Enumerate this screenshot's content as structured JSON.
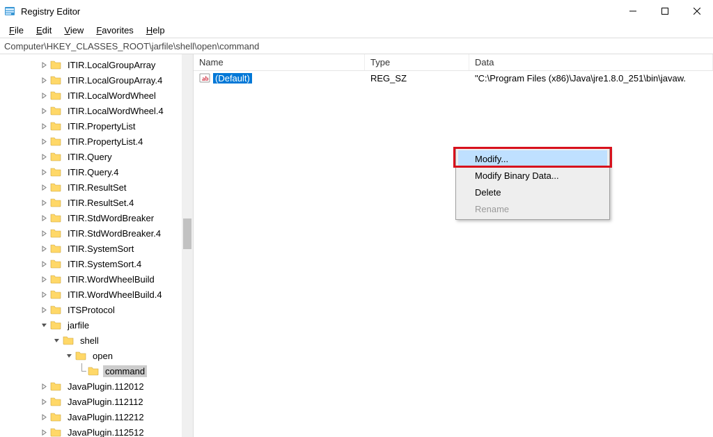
{
  "title": "Registry Editor",
  "menus": {
    "file": "File",
    "edit": "Edit",
    "view": "View",
    "favorites": "Favorites",
    "help": "Help"
  },
  "address": "Computer\\HKEY_CLASSES_ROOT\\jarfile\\shell\\open\\command",
  "tree": [
    {
      "label": "ITIR.LocalGroupArray",
      "depth": 2,
      "expander": "closed"
    },
    {
      "label": "ITIR.LocalGroupArray.4",
      "depth": 2,
      "expander": "closed"
    },
    {
      "label": "ITIR.LocalWordWheel",
      "depth": 2,
      "expander": "closed"
    },
    {
      "label": "ITIR.LocalWordWheel.4",
      "depth": 2,
      "expander": "closed"
    },
    {
      "label": "ITIR.PropertyList",
      "depth": 2,
      "expander": "closed"
    },
    {
      "label": "ITIR.PropertyList.4",
      "depth": 2,
      "expander": "closed"
    },
    {
      "label": "ITIR.Query",
      "depth": 2,
      "expander": "closed"
    },
    {
      "label": "ITIR.Query.4",
      "depth": 2,
      "expander": "closed"
    },
    {
      "label": "ITIR.ResultSet",
      "depth": 2,
      "expander": "closed"
    },
    {
      "label": "ITIR.ResultSet.4",
      "depth": 2,
      "expander": "closed"
    },
    {
      "label": "ITIR.StdWordBreaker",
      "depth": 2,
      "expander": "closed"
    },
    {
      "label": "ITIR.StdWordBreaker.4",
      "depth": 2,
      "expander": "closed"
    },
    {
      "label": "ITIR.SystemSort",
      "depth": 2,
      "expander": "closed"
    },
    {
      "label": "ITIR.SystemSort.4",
      "depth": 2,
      "expander": "closed"
    },
    {
      "label": "ITIR.WordWheelBuild",
      "depth": 2,
      "expander": "closed"
    },
    {
      "label": "ITIR.WordWheelBuild.4",
      "depth": 2,
      "expander": "closed"
    },
    {
      "label": "ITSProtocol",
      "depth": 2,
      "expander": "closed"
    },
    {
      "label": "jarfile",
      "depth": 2,
      "expander": "open"
    },
    {
      "label": "shell",
      "depth": 3,
      "expander": "open"
    },
    {
      "label": "open",
      "depth": 4,
      "expander": "open"
    },
    {
      "label": "command",
      "depth": 5,
      "expander": "leaf",
      "selected": true
    },
    {
      "label": "JavaPlugin.112012",
      "depth": 2,
      "expander": "closed"
    },
    {
      "label": "JavaPlugin.112112",
      "depth": 2,
      "expander": "closed"
    },
    {
      "label": "JavaPlugin.112212",
      "depth": 2,
      "expander": "closed"
    },
    {
      "label": "JavaPlugin.112512",
      "depth": 2,
      "expander": "closed"
    }
  ],
  "list": {
    "headers": {
      "name": "Name",
      "type": "Type",
      "data": "Data"
    },
    "rows": [
      {
        "name": "(Default)",
        "type": "REG_SZ",
        "data": "\"C:\\Program Files (x86)\\Java\\jre1.8.0_251\\bin\\javaw."
      }
    ]
  },
  "context_menu": {
    "modify": "Modify...",
    "modify_binary": "Modify Binary Data...",
    "delete": "Delete",
    "rename": "Rename"
  }
}
